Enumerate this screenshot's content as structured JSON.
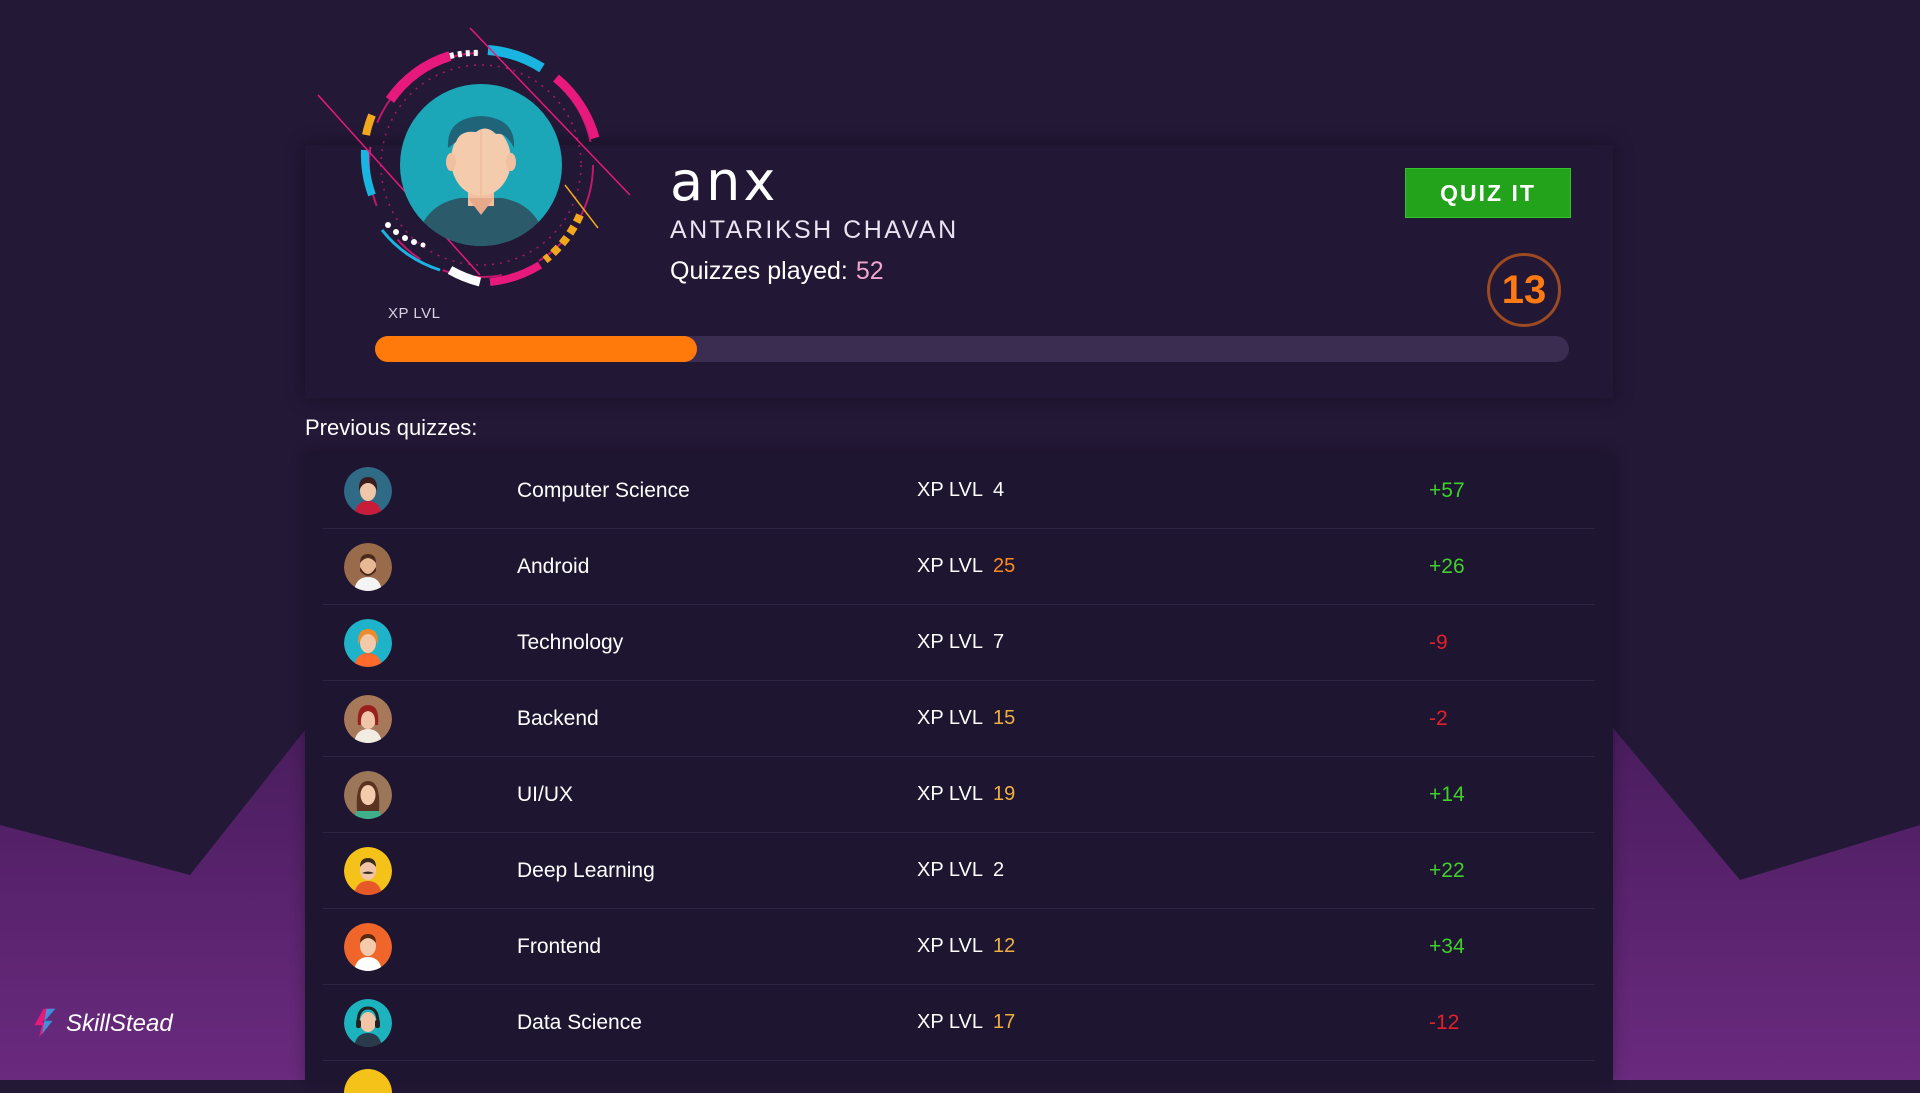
{
  "profile": {
    "username": "anx",
    "full_name": "ANTARIKSH CHAVAN",
    "quizzes_played_label": "Quizzes played:",
    "quizzes_played_value": "52",
    "xp_label": "XP LVL",
    "level": "13",
    "xp_progress": 0.27
  },
  "actions": {
    "quiz_button": "QUIZ IT"
  },
  "history": {
    "title": "Previous quizzes:",
    "xp_label": "XP LVL",
    "rows": [
      {
        "subject": "Computer Science",
        "level": "4",
        "delta": "+57",
        "avatar": "woman-dark-hair-avatar-icon"
      },
      {
        "subject": "Android",
        "level": "25",
        "delta": "+26",
        "avatar": "bearded-man-avatar-icon"
      },
      {
        "subject": "Technology",
        "level": "7",
        "delta": "-9",
        "avatar": "woman-orange-hair-avatar-icon"
      },
      {
        "subject": "Backend",
        "level": "15",
        "delta": "-2",
        "avatar": "woman-red-hair-avatar-icon"
      },
      {
        "subject": "UI/UX",
        "level": "19",
        "delta": "+14",
        "avatar": "woman-long-hair-avatar-icon"
      },
      {
        "subject": "Deep Learning",
        "level": "2",
        "delta": "+22",
        "avatar": "man-mustache-avatar-icon"
      },
      {
        "subject": "Frontend",
        "level": "12",
        "delta": "+34",
        "avatar": "man-orange-background-avatar-icon"
      },
      {
        "subject": "Data Science",
        "level": "17",
        "delta": "-12",
        "avatar": "man-headphones-avatar-icon"
      }
    ]
  },
  "brand": {
    "name": "SkillStead"
  },
  "colors": {
    "background": "#231836",
    "accent_orange": "#ff7a0b",
    "button_green": "#22a31b",
    "positive": "#3fd12a",
    "negative": "#e4202c"
  }
}
